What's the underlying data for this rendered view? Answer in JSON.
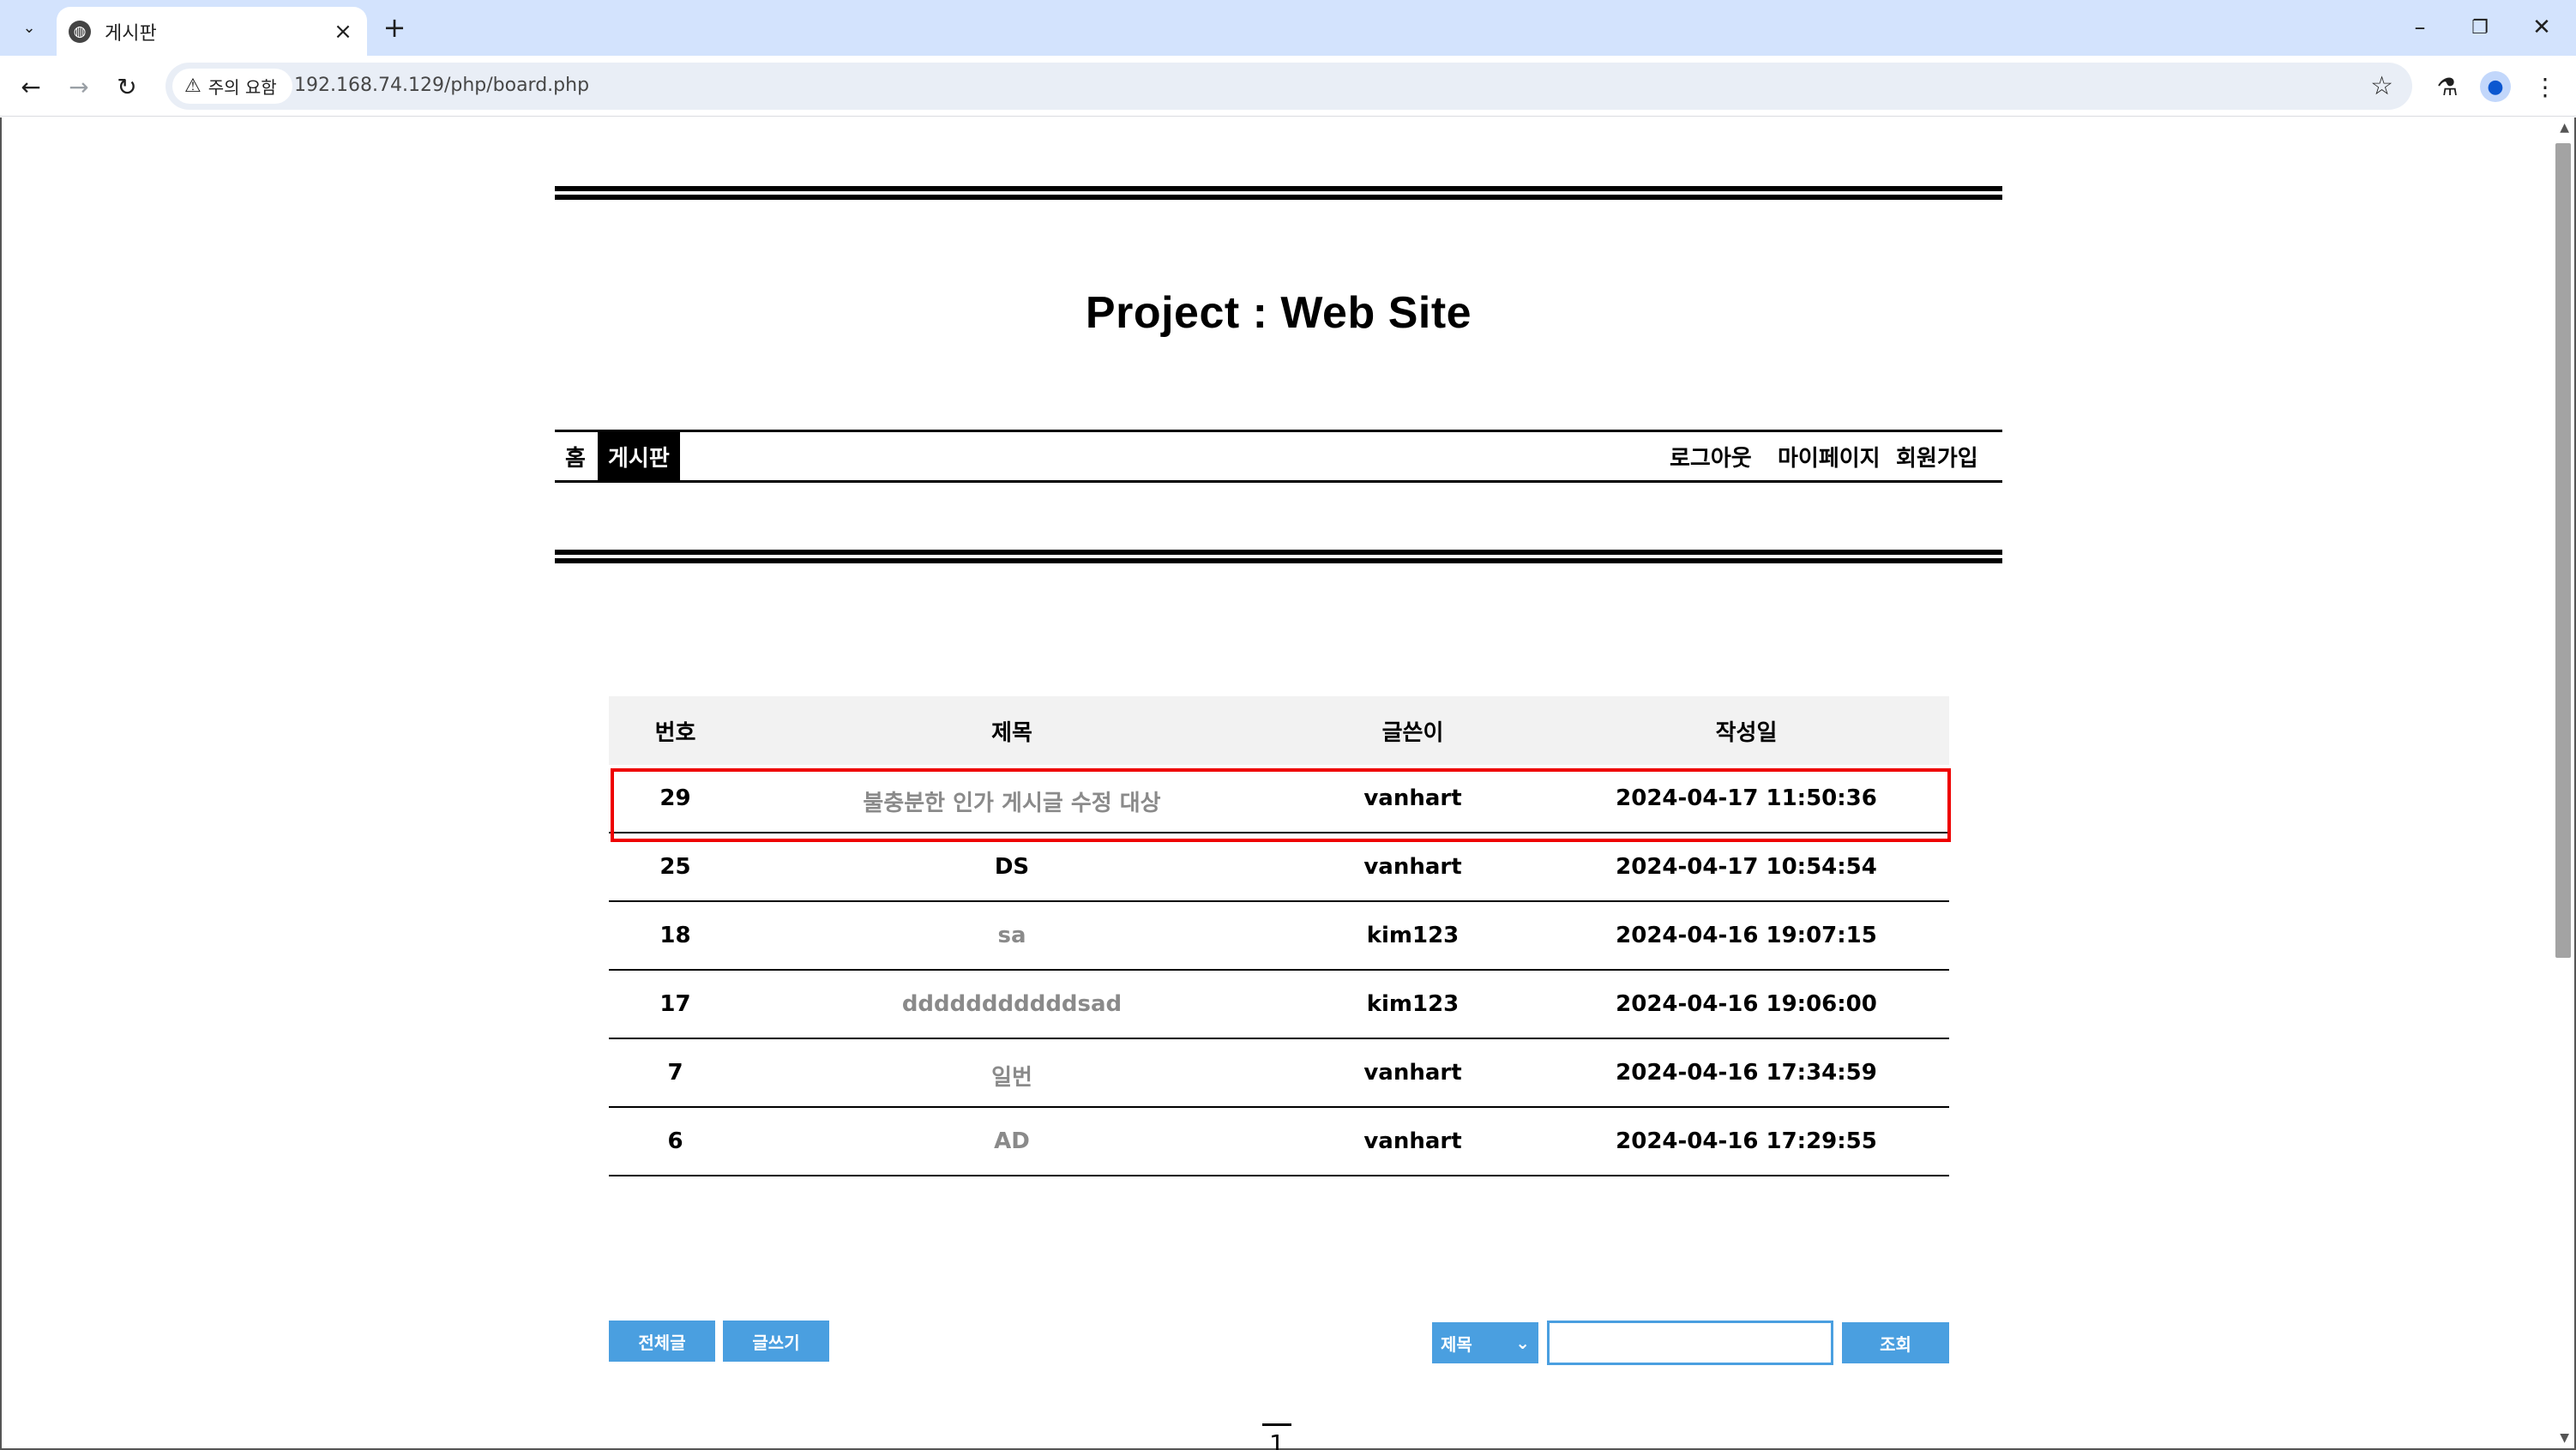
{
  "browser": {
    "tab_title": "게시판",
    "security_label": "주의 요함",
    "url": "192.168.74.129/php/board.php"
  },
  "site": {
    "title": "Project : Web Site",
    "nav_left": [
      "홈",
      "게시판"
    ],
    "active_nav": "게시판",
    "nav_right": [
      "로그아웃",
      "마이페이지",
      "회원가입"
    ]
  },
  "board": {
    "headers": [
      "번호",
      "제목",
      "글쓴이",
      "작성일"
    ],
    "rows": [
      {
        "num": "29",
        "title": "불충분한 인가 게시글 수정 대상",
        "writer": "vanhart",
        "date": "2024-04-17 11:50:36"
      },
      {
        "num": "25",
        "title": "DS",
        "writer": "vanhart",
        "date": "2024-04-17 10:54:54"
      },
      {
        "num": "18",
        "title": "sa",
        "writer": "kim123",
        "date": "2024-04-16 19:07:15"
      },
      {
        "num": "17",
        "title": "dddddddddddsad",
        "writer": "kim123",
        "date": "2024-04-16 19:06:00"
      },
      {
        "num": "7",
        "title": "일번",
        "writer": "vanhart",
        "date": "2024-04-16 17:34:59"
      },
      {
        "num": "6",
        "title": "AD",
        "writer": "vanhart",
        "date": "2024-04-16 17:29:55"
      }
    ],
    "buttons": {
      "all_posts": "전체글",
      "write": "글쓰기",
      "search": "조회"
    },
    "search_field": {
      "selected": "제목",
      "value": ""
    },
    "page": "1"
  },
  "colors": {
    "button": "#4a9fe0",
    "highlight": "#e00000",
    "tabstrip": "#d3e3fd"
  }
}
